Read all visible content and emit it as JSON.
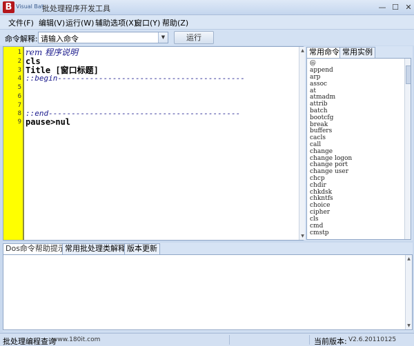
{
  "window": {
    "brand": "Visual Bat",
    "title": "批处理程序开发工具",
    "logo_letter": "B",
    "min_glyph": "—",
    "max_glyph": "☐",
    "close_glyph": "✕"
  },
  "menu": [
    {
      "label": "文件(F)"
    },
    {
      "label": "编辑(V)"
    },
    {
      "label": "运行(W)"
    },
    {
      "label": "辅助选项(X)"
    },
    {
      "label": "窗口(Y)"
    },
    {
      "label": "帮助(Z)"
    }
  ],
  "toolbar": {
    "cmd_label": "命令解释:",
    "cmd_value": "请输入命令",
    "run_label": "运行"
  },
  "editor": {
    "line_numbers": [
      "1",
      "2",
      "3",
      "4",
      "5",
      "6",
      "7",
      "8",
      "9"
    ],
    "lines": [
      "rem 程序说明",
      "cls",
      "Title [窗口标题]",
      "::begin-----------------------------------------",
      "",
      "",
      "",
      "::end------------------------------------------",
      "pause>nul"
    ]
  },
  "side_tabs": [
    "常用命令",
    "常用实例"
  ],
  "commands": [
    "@",
    "append",
    "arp",
    "assoc",
    "at",
    "atmadm",
    "attrib",
    "batch",
    "bootcfg",
    "break",
    "buffers",
    "cacls",
    "call",
    "change",
    "change logon",
    "change port",
    "change user",
    "chcp",
    "chdir",
    "chkdsk",
    "chkntfs",
    "choice",
    "cipher",
    "cls",
    "cmd",
    "cmstp"
  ],
  "bottom_tabs": [
    "Dos命令帮助提示",
    "常用批处理类解释",
    "版本更新"
  ],
  "status": {
    "left": "批处理编程查询",
    "site": "www.180it.com",
    "version_label": "当前版本:",
    "version": "V2.6.20110125"
  },
  "colors": {
    "gutter": "#ffff00",
    "logo": "#b4161b",
    "comment": "#1a1a8c"
  }
}
